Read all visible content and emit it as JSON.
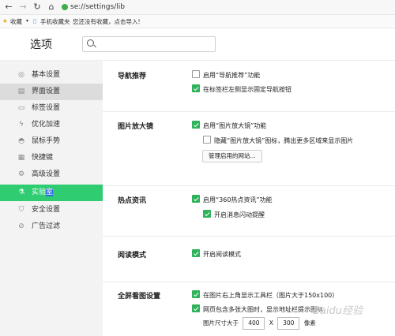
{
  "browser": {
    "url": "se://settings/lib",
    "icons": [
      "arrow-left-icon",
      "arrow-right-icon",
      "refresh-icon",
      "home-icon"
    ]
  },
  "bookmarks": {
    "favorites": "收藏",
    "mobile": "手机收藏夹",
    "import_prompt": "您还没有收藏，点击导入!"
  },
  "header": {
    "title": "选项",
    "search_placeholder": ""
  },
  "sidebar": {
    "items": [
      {
        "label": "基本设置",
        "icon": "gear-icon",
        "glyph": "◎"
      },
      {
        "label": "界面设置",
        "icon": "window-icon",
        "glyph": "▤"
      },
      {
        "label": "标签设置",
        "icon": "tab-icon",
        "glyph": "▭"
      },
      {
        "label": "优化加速",
        "icon": "lightning-icon",
        "glyph": "ϟ"
      },
      {
        "label": "鼠标手势",
        "icon": "mouse-icon",
        "glyph": "◓"
      },
      {
        "label": "快捷键",
        "icon": "keyboard-icon",
        "glyph": "▦"
      },
      {
        "label": "高级设置",
        "icon": "advanced-icon",
        "glyph": "⚙"
      },
      {
        "label_a": "实验",
        "label_b": "室",
        "icon": "flask-icon",
        "glyph": "⚗"
      },
      {
        "label": "安全设置",
        "icon": "shield-icon",
        "glyph": "⛉"
      },
      {
        "label": "广告过滤",
        "icon": "block-icon",
        "glyph": "⊘"
      }
    ],
    "active_color": "#2fcc71"
  },
  "sections": {
    "nav": {
      "title": "导航推荐",
      "opt1": "启用“导航推荐”功能",
      "opt2": "在标签栏左侧显示固定导航按钮"
    },
    "zoom": {
      "title": "图片放大镜",
      "opt1": "启用“图片放大镜”功能",
      "opt2": "隐藏“图片放大镜”图标，腾出更多区域来显示图片",
      "button": "管理启用的网站..."
    },
    "hot": {
      "title": "热点资讯",
      "opt1": "启用“360热点资讯”功能",
      "opt2": "开启消息闪动提醒"
    },
    "reader": {
      "title": "阅读模式",
      "opt1": "开启阅读模式"
    },
    "fullscreen": {
      "title": "全屏看图设置",
      "opt1": "在图片右上角显示工具栏（图片大于150x100）",
      "opt2": "网页包含多张大图时，显示地址栏提示图标",
      "size_label": "图片尺寸大于",
      "width": "400",
      "sep": "X",
      "height": "300",
      "unit": "像素"
    }
  }
}
